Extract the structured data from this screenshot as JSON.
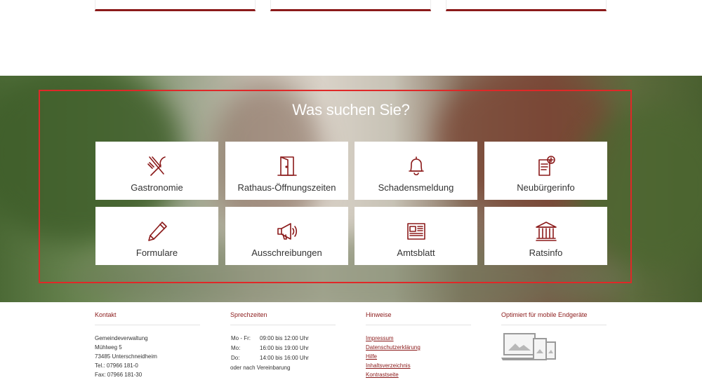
{
  "hero": {
    "title": "Was suchen Sie?",
    "tiles": [
      {
        "label": "Gastronomie",
        "icon": "cutlery-icon"
      },
      {
        "label": "Rathaus-Öffnungszeiten",
        "icon": "door-icon"
      },
      {
        "label": "Schadensmeldung",
        "icon": "bell-icon"
      },
      {
        "label": "Neubürgerinfo",
        "icon": "document-plus-icon"
      },
      {
        "label": "Formulare",
        "icon": "pencil-icon"
      },
      {
        "label": "Ausschreibungen",
        "icon": "megaphone-icon"
      },
      {
        "label": "Amtsblatt",
        "icon": "newspaper-icon"
      },
      {
        "label": "Ratsinfo",
        "icon": "townhall-icon"
      }
    ]
  },
  "footer": {
    "contact": {
      "heading": "Kontakt",
      "lines": [
        "Gemeindeverwaltung",
        "Mühlweg 5",
        "73485 Unterschneidheim",
        "Tel.: 07966 181-0",
        "Fax: 07966 181-30"
      ]
    },
    "hours": {
      "heading": "Sprechzeiten",
      "rows": [
        {
          "day": "Mo - Fr:",
          "time": "09:00 bis 12:00 Uhr"
        },
        {
          "day": "Mo:",
          "time": "16:00 bis 19:00 Uhr"
        },
        {
          "day": "Do:",
          "time": "14:00 bis 16:00 Uhr"
        }
      ],
      "note": "oder nach Vereinbarung"
    },
    "hints": {
      "heading": "Hinweise",
      "links": [
        "Impressum",
        "Datenschutzerklärung",
        "Hilfe",
        "Inhaltsverzeichnis",
        "Kontrastseite"
      ]
    },
    "mobile": {
      "heading": "Optimiert für mobile Endgeräte",
      "icon": "devices-icon"
    }
  },
  "colors": {
    "accent": "#8b1a1a",
    "frame": "#e02828"
  }
}
